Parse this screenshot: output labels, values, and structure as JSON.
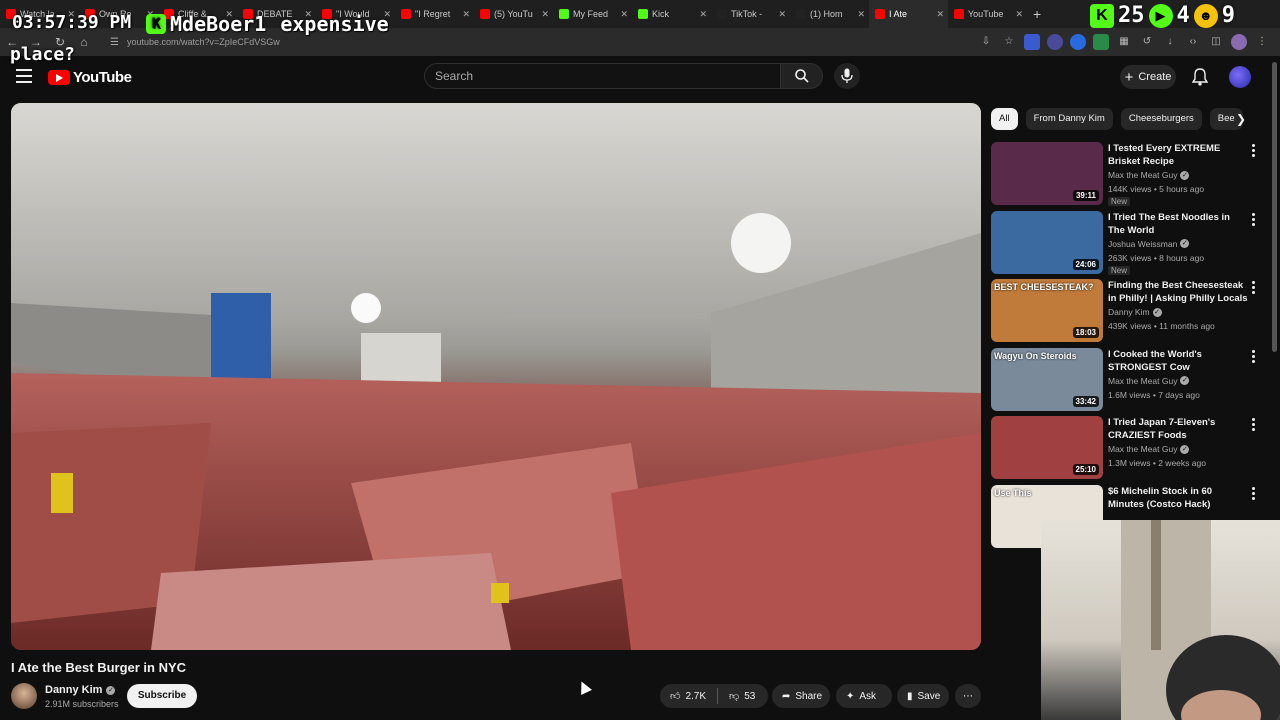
{
  "browser": {
    "tabs": [
      {
        "label": "Watch la",
        "color": "#ff0000",
        "active": false
      },
      {
        "label": "Own Re",
        "color": "#ff0000",
        "active": false
      },
      {
        "label": "Cliffe &",
        "color": "#ff0000",
        "active": false
      },
      {
        "label": "DEBATE",
        "color": "#ff0000",
        "active": false
      },
      {
        "label": "\"I Would",
        "color": "#ff0000",
        "active": false
      },
      {
        "label": "\"I Regret",
        "color": "#ff0000",
        "active": false
      },
      {
        "label": "(5) YouTu",
        "color": "#ff0000",
        "active": false
      },
      {
        "label": "My Feed",
        "color": "#53fc18",
        "active": false
      },
      {
        "label": "Kick",
        "color": "#53fc18",
        "active": false
      },
      {
        "label": "TikTok -",
        "color": "#222222",
        "active": false
      },
      {
        "label": "(1) Hom",
        "color": "#222222",
        "active": false
      },
      {
        "label": "I Ate",
        "color": "#ff0000",
        "active": true
      },
      {
        "label": "YouTube",
        "color": "#ff0000",
        "active": false
      }
    ],
    "url": "youtube.com/watch?v=ZpIeCFdVSGw"
  },
  "overlay": {
    "time": "03:57:39 PM",
    "chat_user": "MdeBoer1",
    "chat_text_1": "expensive",
    "chat_text_2": "place?",
    "stat_1": "25",
    "stat_2": "4",
    "stat_3": "9",
    "kick_color": "#53fc18"
  },
  "header": {
    "logo_text": "YouTube",
    "search_placeholder": "Search",
    "create_label": "Create"
  },
  "video": {
    "title": "I Ate the Best Burger in NYC",
    "channel": "Danny Kim",
    "subscribers": "2.91M subscribers",
    "subscribe_label": "Subscribe",
    "likes": "2.7K",
    "dislikes": "53",
    "share_label": "Share",
    "ask_label": "Ask",
    "save_label": "Save"
  },
  "chips": [
    "All",
    "From Danny Kim",
    "Cheeseburgers",
    "Bee"
  ],
  "recommendations": [
    {
      "title": "I Tested Every EXTREME Brisket Recipe",
      "channel": "Max the Meat Guy",
      "meta": "144K views • 5 hours ago",
      "badge": "New",
      "duration": "39:11",
      "thumb": "#5a2a4a"
    },
    {
      "title": "I Tried The Best Noodles in The World",
      "channel": "Joshua Weissman",
      "meta": "263K views • 8 hours ago",
      "badge": "New",
      "duration": "24:06",
      "thumb": "#3a6aa0"
    },
    {
      "title": "Finding the Best Cheesesteak in Philly! | Asking Philly Locals | ...",
      "channel": "Danny Kim",
      "meta": "439K views • 11 months ago",
      "badge": "",
      "duration": "18:03",
      "thumb": "#c07a3a",
      "thumb_text": "BEST CHEESESTEAK?"
    },
    {
      "title": "I Cooked the World's STRONGEST Cow",
      "channel": "Max the Meat Guy",
      "meta": "1.6M views • 7 days ago",
      "badge": "",
      "duration": "33:42",
      "thumb": "#7a8a9a",
      "thumb_text": "Wagyu On Steroids"
    },
    {
      "title": "I Tried Japan 7-Eleven's CRAZIEST Foods",
      "channel": "Max the Meat Guy",
      "meta": "1.3M views • 2 weeks ago",
      "badge": "",
      "duration": "25:10",
      "thumb": "#a04040"
    },
    {
      "title": "$6 Michelin Stock in 60 Minutes (Costco Hack)",
      "channel": "",
      "meta": "",
      "badge": "",
      "duration": "",
      "thumb": "#e8e2d8",
      "thumb_text": "Use This"
    }
  ]
}
